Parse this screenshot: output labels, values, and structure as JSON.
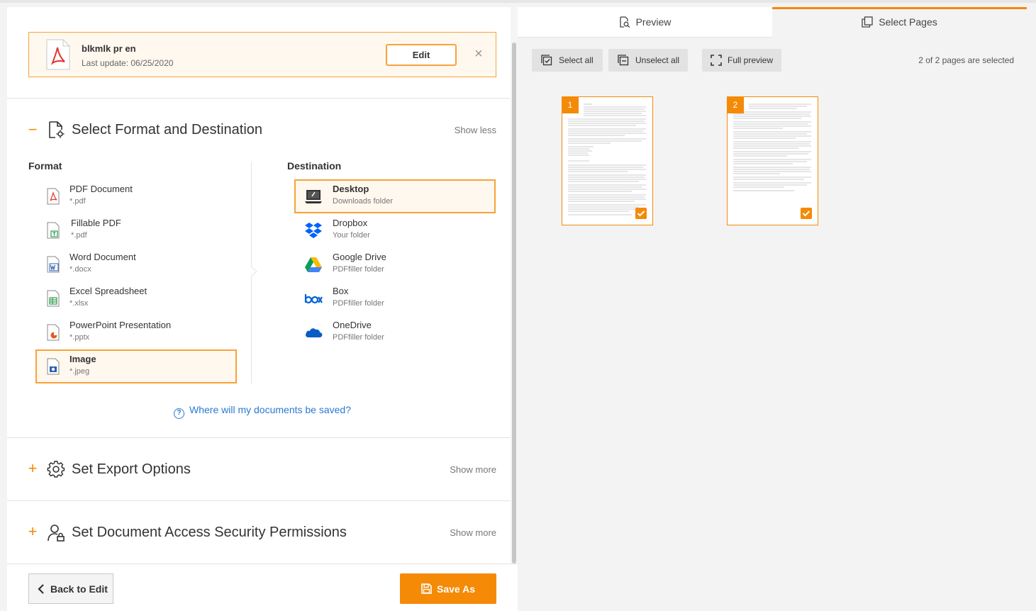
{
  "file": {
    "name": "blkmlk pr en",
    "last_update": "Last update: 06/25/2020",
    "edit_label": "Edit",
    "close_glyph": "×"
  },
  "format_section": {
    "title": "Select Format and Destination",
    "toggle": "−",
    "link": "Show less",
    "format_heading": "Format",
    "destination_heading": "Destination",
    "formats": [
      {
        "name": "PDF Document",
        "ext": "*.pdf",
        "icon": "pdf-file-icon"
      },
      {
        "name": "Fillable PDF",
        "ext": "*.pdf",
        "icon": "fillable-pdf-icon"
      },
      {
        "name": "Word Document",
        "ext": "*.docx",
        "icon": "word-file-icon"
      },
      {
        "name": "Excel Spreadsheet",
        "ext": "*.xlsx",
        "icon": "excel-file-icon"
      },
      {
        "name": "PowerPoint Presentation",
        "ext": "*.pptx",
        "icon": "powerpoint-file-icon"
      },
      {
        "name": "Image",
        "ext": "*.jpeg",
        "icon": "image-file-icon",
        "selected": true
      }
    ],
    "destinations": [
      {
        "name": "Desktop",
        "sub": "Downloads folder",
        "icon": "desktop-icon",
        "selected": true
      },
      {
        "name": "Dropbox",
        "sub": "Your folder",
        "icon": "dropbox-icon"
      },
      {
        "name": "Google Drive",
        "sub": "PDFfiller folder",
        "icon": "google-drive-icon"
      },
      {
        "name": "Box",
        "sub": "PDFfiller folder",
        "icon": "box-icon"
      },
      {
        "name": "OneDrive",
        "sub": "PDFfiller folder",
        "icon": "onedrive-icon"
      }
    ],
    "help_text": "Where will my documents be saved?",
    "help_glyph": "?"
  },
  "export_section": {
    "title": "Set Export Options",
    "toggle": "+",
    "link": "Show more"
  },
  "security_section": {
    "title": "Set Document Access Security Permissions",
    "toggle": "+",
    "link": "Show more"
  },
  "bottom": {
    "back_label": "Back to Edit",
    "save_label": "Save As"
  },
  "right": {
    "tabs": {
      "preview": "Preview",
      "select_pages": "Select Pages"
    },
    "toolbar": {
      "select_all": "Select all",
      "unselect_all": "Unselect all",
      "full_preview": "Full preview"
    },
    "pages_count": "2 of 2 pages are selected",
    "pages": [
      {
        "number": "1",
        "selected": true
      },
      {
        "number": "2",
        "selected": true
      }
    ]
  },
  "colors": {
    "accent": "#f58a07",
    "link": "#2a7ad1"
  }
}
